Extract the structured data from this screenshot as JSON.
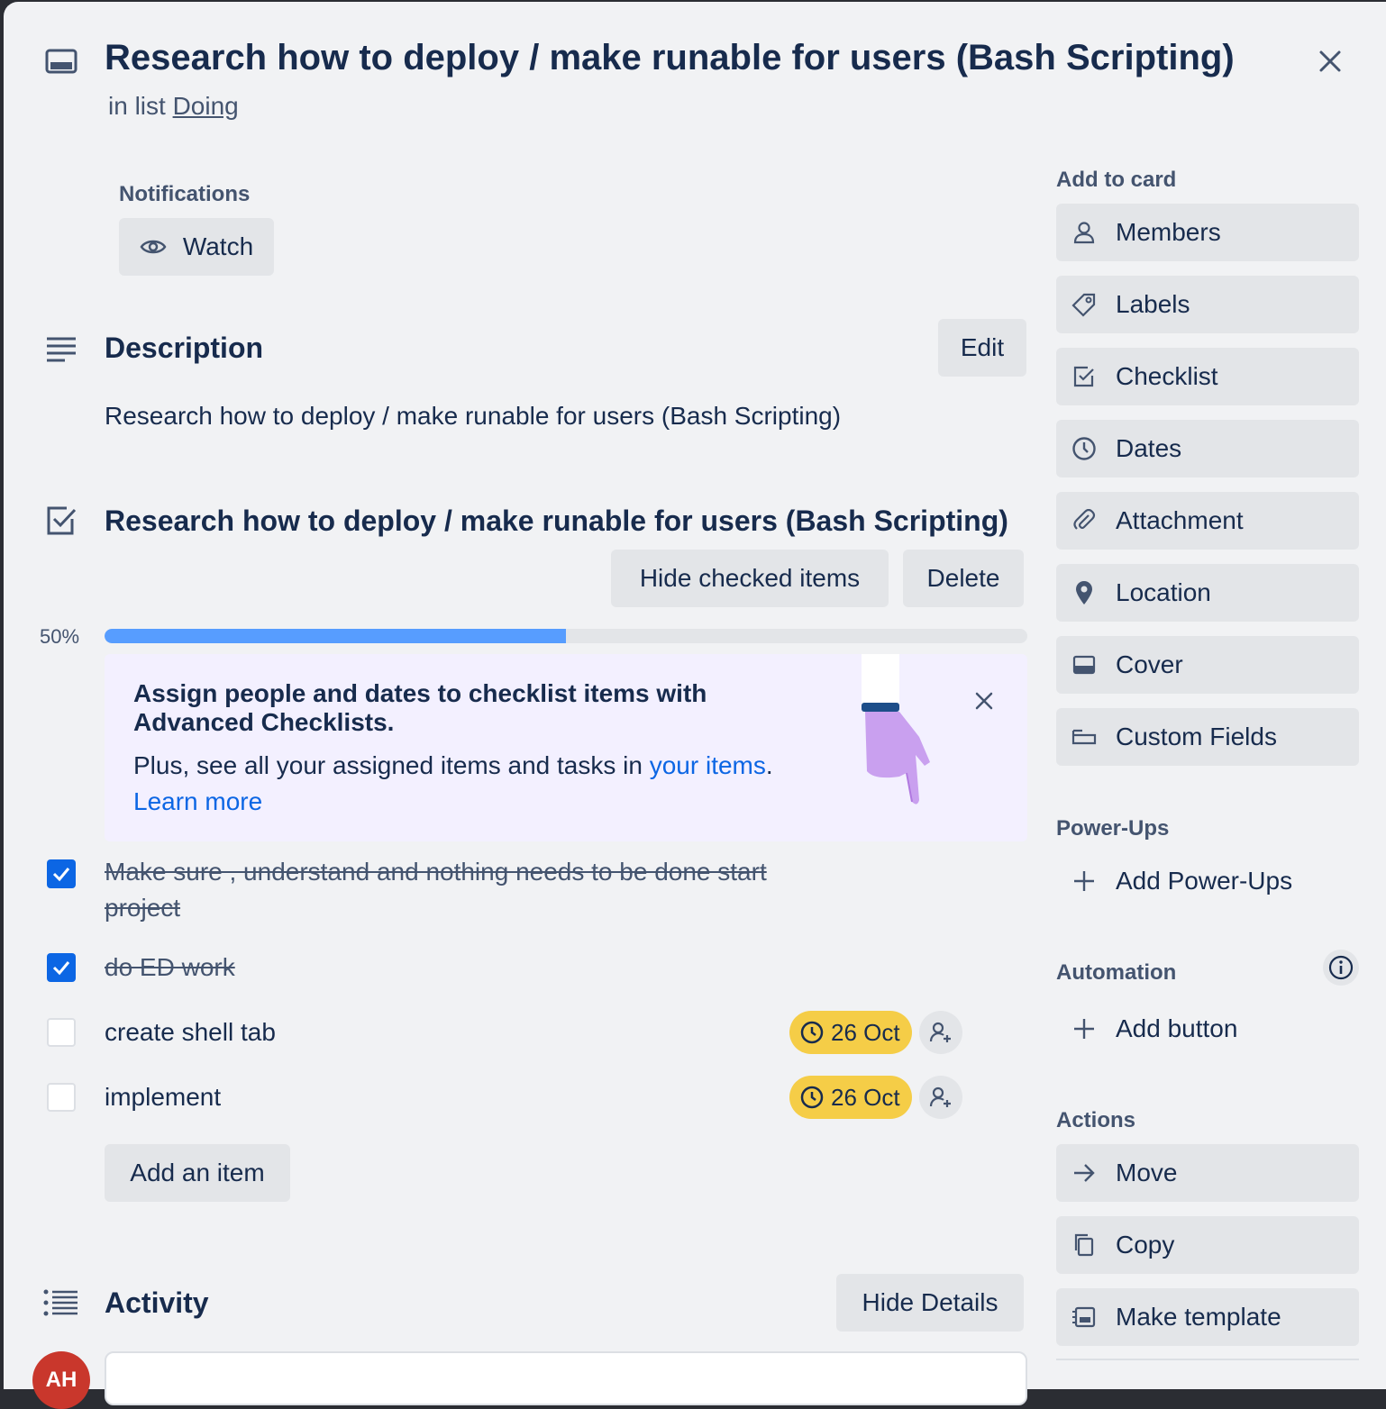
{
  "card": {
    "title": "Research how to deploy / make runable for users (Bash Scripting)",
    "in_list_prefix": "in list",
    "list_name": "Doing"
  },
  "notifications": {
    "label": "Notifications",
    "watch_label": "Watch"
  },
  "description": {
    "heading": "Description",
    "edit_label": "Edit",
    "text": "Research how to deploy / make runable for users (Bash Scripting)"
  },
  "checklist": {
    "title": "Research how to deploy / make runable for users (Bash Scripting)",
    "hide_checked_label": "Hide checked items",
    "delete_label": "Delete",
    "progress_label": "50%",
    "progress_fraction": 0.5,
    "promo": {
      "title": "Assign people and dates to checklist items with Advanced Checklists.",
      "text_prefix": "Plus, see all your assigned items and tasks in",
      "text_link": "your items",
      "text_suffix": ".",
      "learn_more": "Learn more"
    },
    "items": [
      {
        "text": "Make sure , understand and nothing needs to be done start project",
        "checked": true
      },
      {
        "text": "do ED work",
        "checked": true
      },
      {
        "text": "create shell tab",
        "checked": false,
        "due": "26 Oct"
      },
      {
        "text": "implement",
        "checked": false,
        "due": "26 Oct"
      }
    ],
    "add_item_label": "Add an item"
  },
  "activity": {
    "heading": "Activity",
    "hide_details_label": "Hide Details",
    "avatar_initials": "AH"
  },
  "sidebar": {
    "add_to_card_label": "Add to card",
    "add_to_card": [
      {
        "label": "Members",
        "icon": "person-icon"
      },
      {
        "label": "Labels",
        "icon": "tag-icon"
      },
      {
        "label": "Checklist",
        "icon": "checkbox-icon"
      },
      {
        "label": "Dates",
        "icon": "clock-icon"
      },
      {
        "label": "Attachment",
        "icon": "paperclip-icon"
      },
      {
        "label": "Location",
        "icon": "pin-icon"
      },
      {
        "label": "Cover",
        "icon": "cover-icon"
      },
      {
        "label": "Custom Fields",
        "icon": "fields-icon"
      }
    ],
    "powerups_label": "Power-Ups",
    "add_powerups_label": "Add Power-Ups",
    "automation_label": "Automation",
    "add_button_label": "Add button",
    "actions_label": "Actions",
    "actions": [
      {
        "label": "Move",
        "icon": "arrow-right-icon"
      },
      {
        "label": "Copy",
        "icon": "copy-icon"
      },
      {
        "label": "Make template",
        "icon": "template-icon"
      }
    ]
  },
  "colors": {
    "accent": "#0c66e4",
    "progress": "#579dff",
    "due_badge": "#f5cd47",
    "promo_bg": "#f3f0ff"
  }
}
